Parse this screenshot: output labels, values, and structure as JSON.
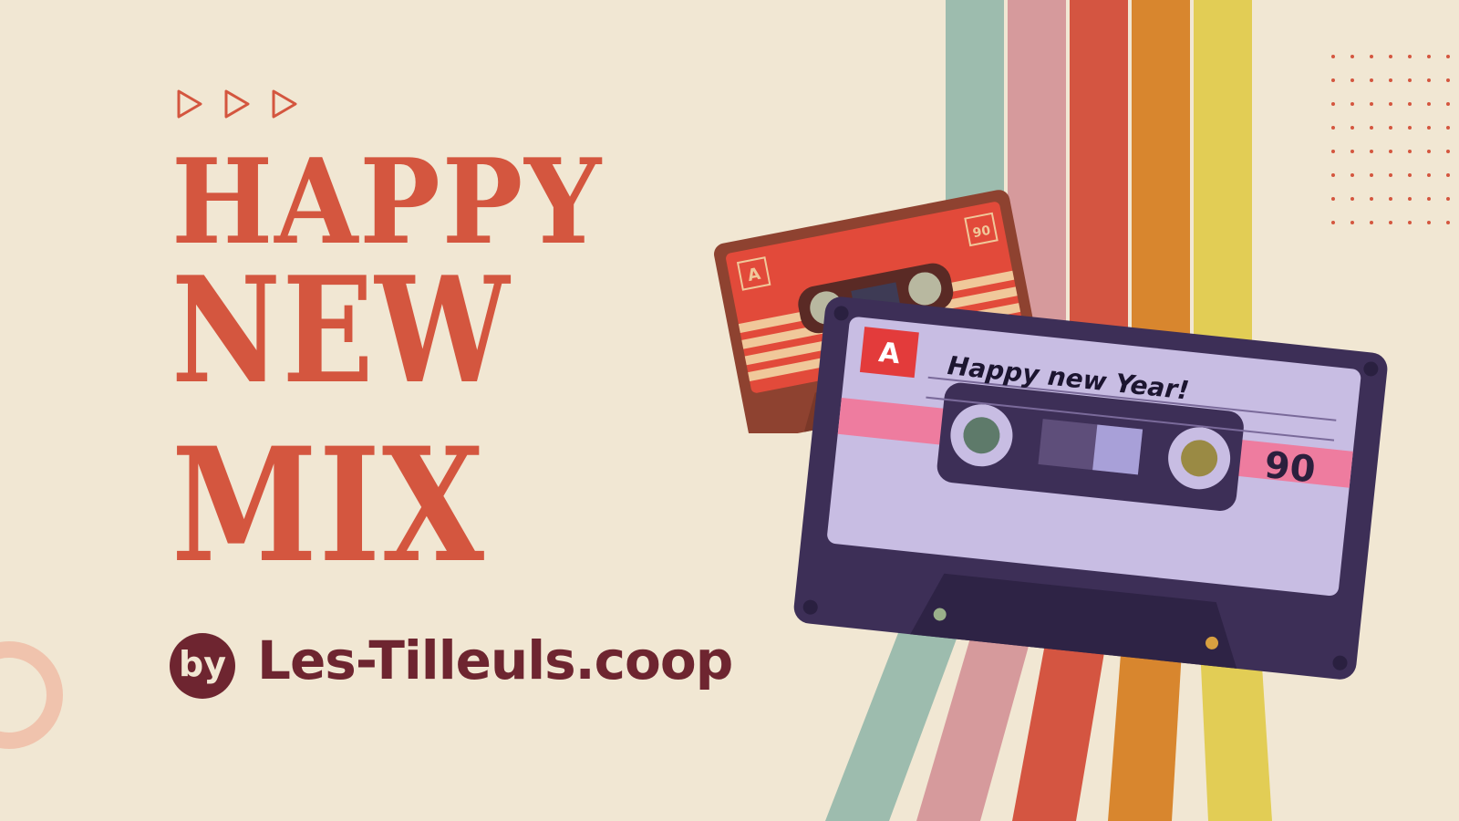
{
  "headline": {
    "line1": "HAPPY",
    "line2": "NEW",
    "line3": "MIX"
  },
  "byline": {
    "by": "by",
    "brand": "Les-Tilleuls.coop"
  },
  "cassette_back": {
    "side": "A",
    "length": "90"
  },
  "cassette_front": {
    "side": "A",
    "label": "Happy new Year!",
    "length": "90"
  },
  "colors": {
    "background": "#f1e7d3",
    "headline": "#d4563f",
    "brand": "#6e2530",
    "stripes": [
      "#9dbcae",
      "#d69a9c",
      "#d45541",
      "#d8862e",
      "#e2cd55"
    ]
  },
  "icons": [
    "play-icon",
    "play-icon",
    "play-icon"
  ]
}
